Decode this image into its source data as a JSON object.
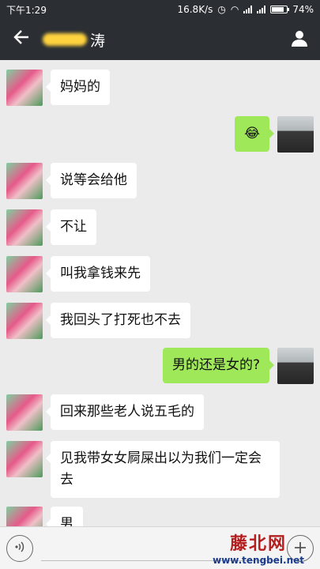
{
  "status_bar": {
    "time": "下午1:29",
    "speed": "16.8K/s",
    "battery": "74%"
  },
  "nav": {
    "title_suffix": "涛"
  },
  "messages": [
    {
      "side": "left",
      "text": "妈妈的"
    },
    {
      "side": "right",
      "text": "😂"
    },
    {
      "side": "left",
      "text": "说等会给他"
    },
    {
      "side": "left",
      "text": "不让"
    },
    {
      "side": "left",
      "text": "叫我拿钱来先"
    },
    {
      "side": "left",
      "text": "我回头了打死也不去"
    },
    {
      "side": "right",
      "text": "男的还是女的?"
    },
    {
      "side": "left",
      "text": "回来那些老人说五毛的"
    },
    {
      "side": "left",
      "text": "见我带女女屙屎出以为我们一定会去"
    },
    {
      "side": "left",
      "text": "男"
    }
  ],
  "watermark": {
    "main": "藤北网",
    "url": "www.tengbei.net"
  },
  "icons": {
    "back": "arrow-left-icon",
    "contact": "person-icon",
    "voice": "voice-icon",
    "more": "plus-icon"
  }
}
